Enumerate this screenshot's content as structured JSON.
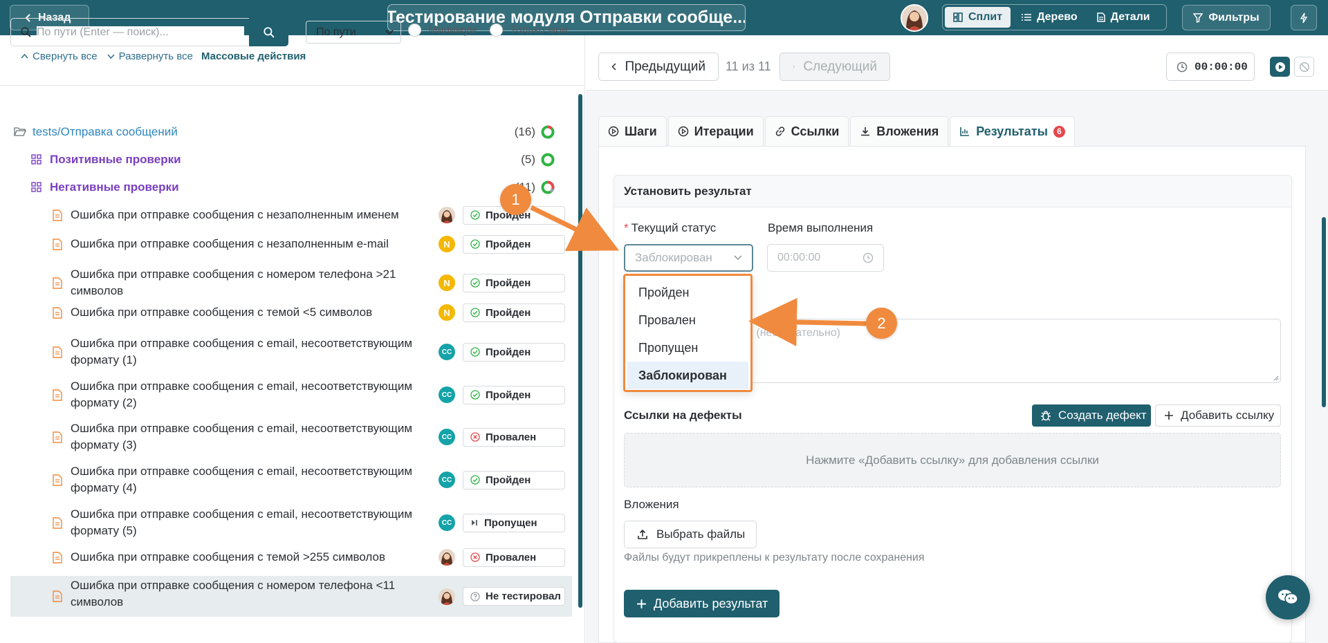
{
  "header": {
    "back_label": "Назад",
    "title": "Тестирование модуля Отправки сообще...",
    "views": [
      "Сплит",
      "Дерево",
      "Детали"
    ],
    "filters_label": "Фильтры"
  },
  "left": {
    "search_placeholder": "По пути (Enter — поиск)...",
    "path_select": "По пути",
    "minimum_label": "Минимум",
    "only_mine_label": "Только мои",
    "collapse_all": "Свернуть все",
    "expand_all": "Развернуть все",
    "mass_actions": "Массовые действия",
    "root": {
      "label": "tests/Отправка сообщений",
      "count": "(16)"
    },
    "groups": [
      {
        "label": "Позитивные проверки",
        "count": "(5)"
      },
      {
        "label": "Негативные проверки",
        "count": "(11)"
      }
    ],
    "cases": [
      {
        "title": "Ошибка при отправке сообщения с незаполненным именем",
        "avatar": "",
        "status": "Пройден"
      },
      {
        "title": "Ошибка при отправке сообщения с незаполненным e-mail",
        "avatar": "N",
        "status": "Пройден"
      },
      {
        "title": "Ошибка при отправке сообщения с номером телефона >21 символов",
        "avatar": "N",
        "status": "Пройден"
      },
      {
        "title": "Ошибка при отправке сообщения с темой <5 символов",
        "avatar": "N",
        "status": "Пройден"
      },
      {
        "title": "Ошибка при отправке сообщения с email, несоответствующим формату (1)",
        "avatar": "CC",
        "status": "Пройден"
      },
      {
        "title": "Ошибка при отправке сообщения с email, несоответствующим формату (2)",
        "avatar": "CC",
        "status": "Пройден"
      },
      {
        "title": "Ошибка при отправке сообщения с email, несоответствующим формату (3)",
        "avatar": "CC",
        "status": "Провален"
      },
      {
        "title": "Ошибка при отправке сообщения с email, несоответствующим формату (4)",
        "avatar": "CC",
        "status": "Пройден"
      },
      {
        "title": "Ошибка при отправке сообщения с email, несоответствующим формату (5)",
        "avatar": "CC",
        "status": "Пропущен"
      },
      {
        "title": "Ошибка при отправке сообщения с темой >255 символов",
        "avatar": "",
        "status": "Провален"
      },
      {
        "title": "Ошибка при отправке сообщения с номером телефона <11 символов",
        "avatar": "",
        "status": "Не тестировал"
      }
    ]
  },
  "nav": {
    "prev_label": "Предыдущий",
    "counter": "11 из 11",
    "next_label": "Следующий",
    "timer": "00:00:00"
  },
  "tabs": [
    {
      "label": "Шаги"
    },
    {
      "label": "Итерации"
    },
    {
      "label": "Ссылки"
    },
    {
      "label": "Вложения"
    },
    {
      "label": "Результаты",
      "badge": "6"
    }
  ],
  "result_form": {
    "header": "Установить результат",
    "status_label": "Текущий статус",
    "status_value": "Заблокирован",
    "time_label": "Время выполнения",
    "time_placeholder": "00:00:00",
    "comment_placeholder": "й (необязательно)",
    "dropdown_options": [
      "Пройден",
      "Провален",
      "Пропущен",
      "Заблокирован"
    ],
    "dropdown_selected": "Заблокирован",
    "defects_label": "Ссылки на дефекты",
    "create_defect_label": "Создать дефект",
    "add_link_label": "Добавить ссылку",
    "links_empty_text": "Нажмите «Добавить ссылку» для добавления ссылки",
    "attachments_label": "Вложения",
    "choose_files_label": "Выбрать файлы",
    "attachments_hint": "Файлы будут прикреплены к результату после сохранения",
    "add_result_label": "Добавить результат"
  },
  "callouts": [
    "1",
    "2"
  ],
  "colors": {
    "primary": "#1f5f6e",
    "accent_orange": "#f08a3e",
    "group_purple": "#7a3fc0",
    "root_blue": "#2e86c1",
    "passed_green": "#2fb344",
    "failed_red": "#e5484d",
    "avatar_n": "#f5b800",
    "avatar_cc": "#14a3a8"
  }
}
